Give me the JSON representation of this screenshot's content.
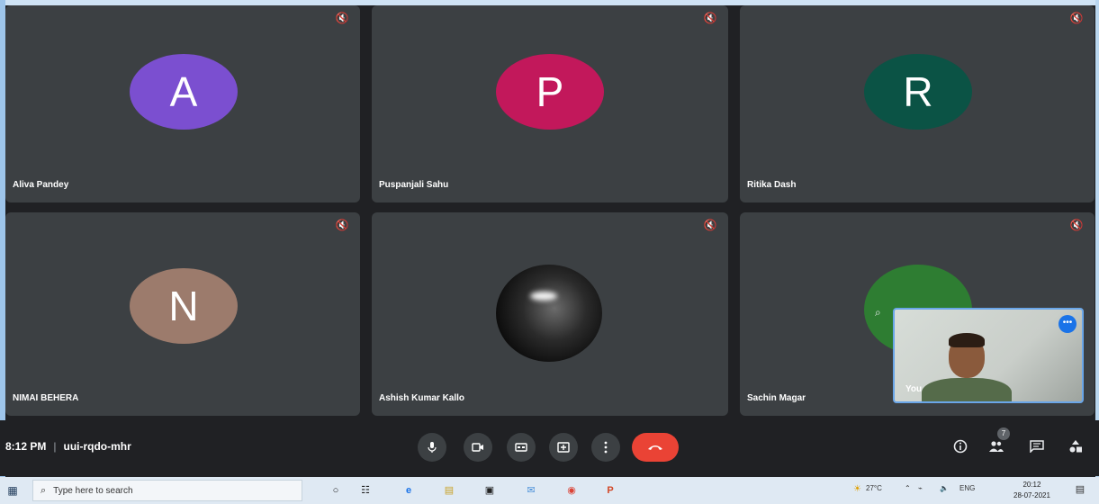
{
  "participants": [
    {
      "name": "Aliva Pandey",
      "initial": "A",
      "color": "#7b4fd0"
    },
    {
      "name": "Puspanjali Sahu",
      "initial": "P",
      "color": "#c2185b"
    },
    {
      "name": "Ritika Dash",
      "initial": "R",
      "color": "#0b5345"
    },
    {
      "name": "NIMAI BEHERA",
      "initial": "N",
      "color": "#9c7b6c"
    },
    {
      "name": "Ashish Kumar Kallo",
      "initial": "",
      "color": "#111111"
    },
    {
      "name": "Sachin Magar",
      "initial": "",
      "color": "#2e7d32"
    }
  ],
  "self_view": {
    "label": "You"
  },
  "meeting": {
    "time": "8:12 PM",
    "separator": "|",
    "code": "uui-rqdo-mhr"
  },
  "controls": {
    "people_count": "7"
  },
  "taskbar": {
    "search_placeholder": "Type here to search",
    "weather": "27°C",
    "language": "ENG",
    "time": "20:12",
    "date": "28-07-2021"
  },
  "colors": {
    "end_call": "#ea4335",
    "tile_bg": "#3c4043",
    "bar_bg": "#202124"
  }
}
